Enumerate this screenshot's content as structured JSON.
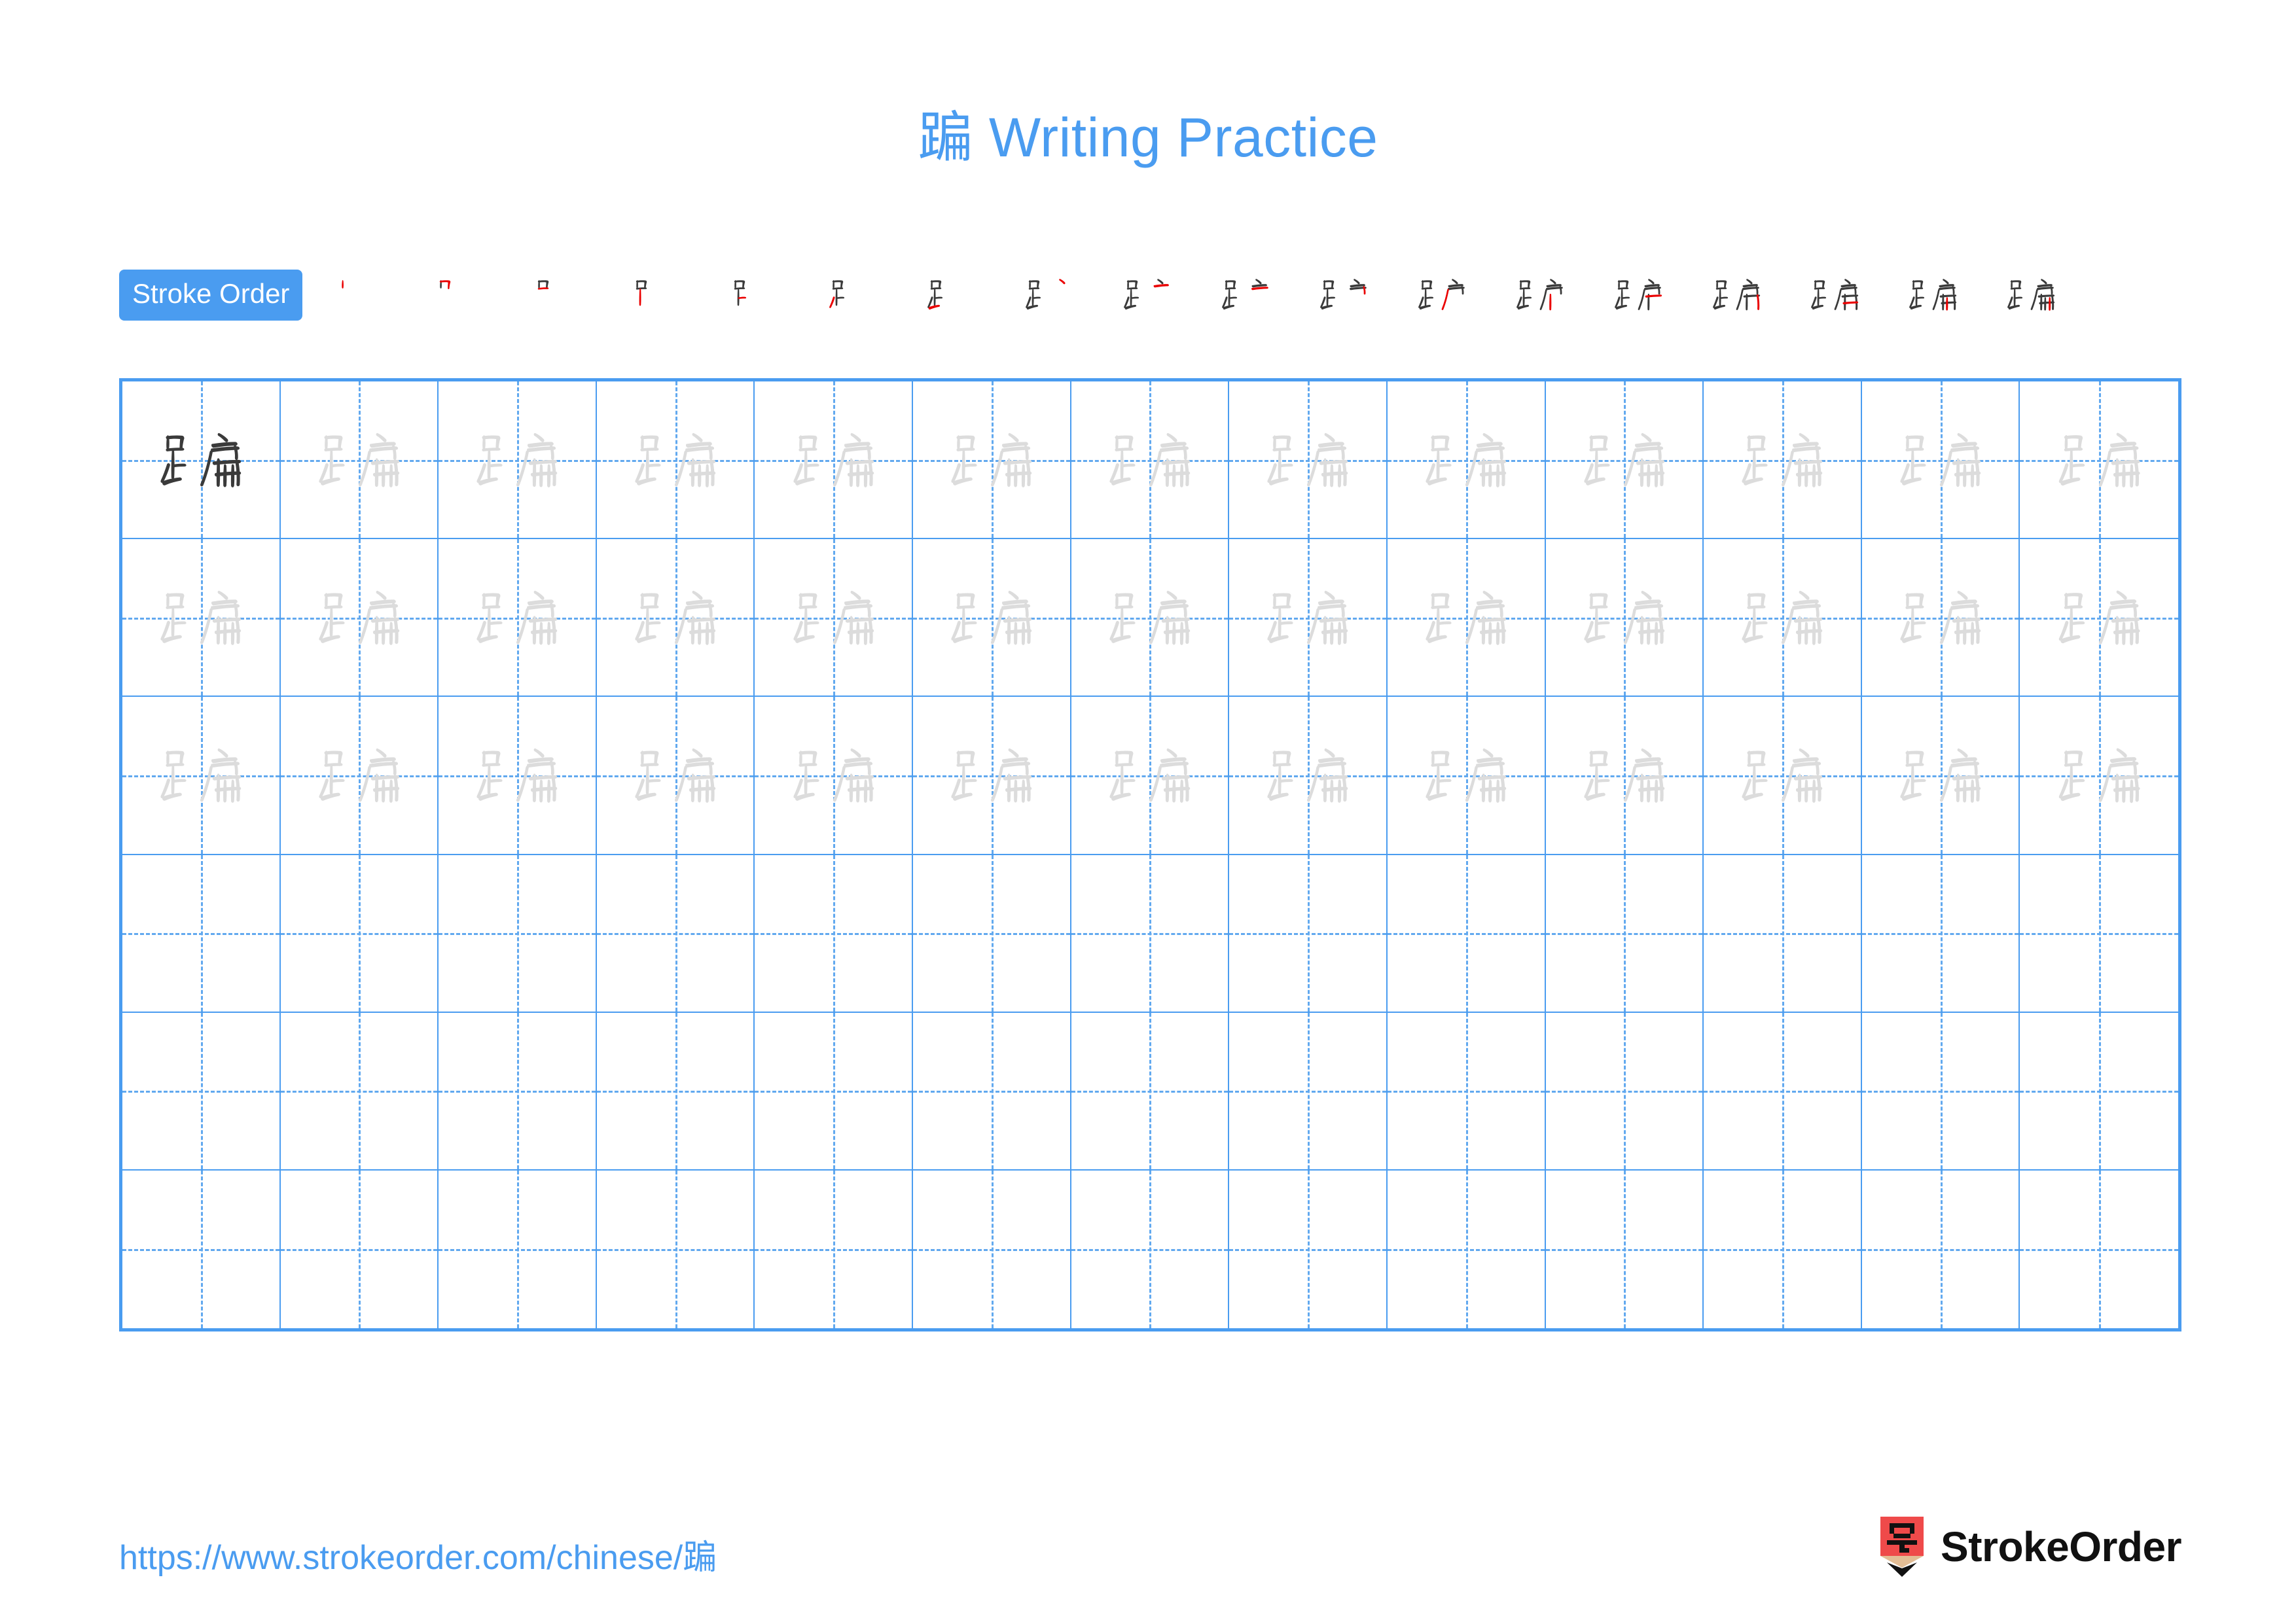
{
  "character": "蹁",
  "colors": {
    "accent_blue": "#4a9cf0",
    "grid_line_blue": "#4a9cf0",
    "guide_dash_blue": "#62a9ef",
    "stroke_done": "#3a3a3a",
    "stroke_new": "#ea0000",
    "ghost_char": "#dcdcdc",
    "logo_red": "#ef4a4a"
  },
  "header": {
    "title": "蹁 Writing Practice"
  },
  "stroke_order": {
    "label": "Stroke Order",
    "total_strokes": 18,
    "steps": [
      1,
      2,
      3,
      4,
      5,
      6,
      7,
      8,
      9,
      10,
      11,
      12,
      13,
      14,
      15,
      16,
      17,
      18
    ]
  },
  "practice_grid": {
    "columns": 13,
    "rows": 6,
    "filled_rows": 3,
    "empty_rows": 3,
    "model_cell": {
      "row": 1,
      "column": 1,
      "style": "dark"
    },
    "traced_cell_style": "ghost"
  },
  "footer": {
    "url": "https://www.strokeorder.com/chinese/蹁",
    "brand_name": "StrokeOrder",
    "logo_glyph": "字"
  }
}
